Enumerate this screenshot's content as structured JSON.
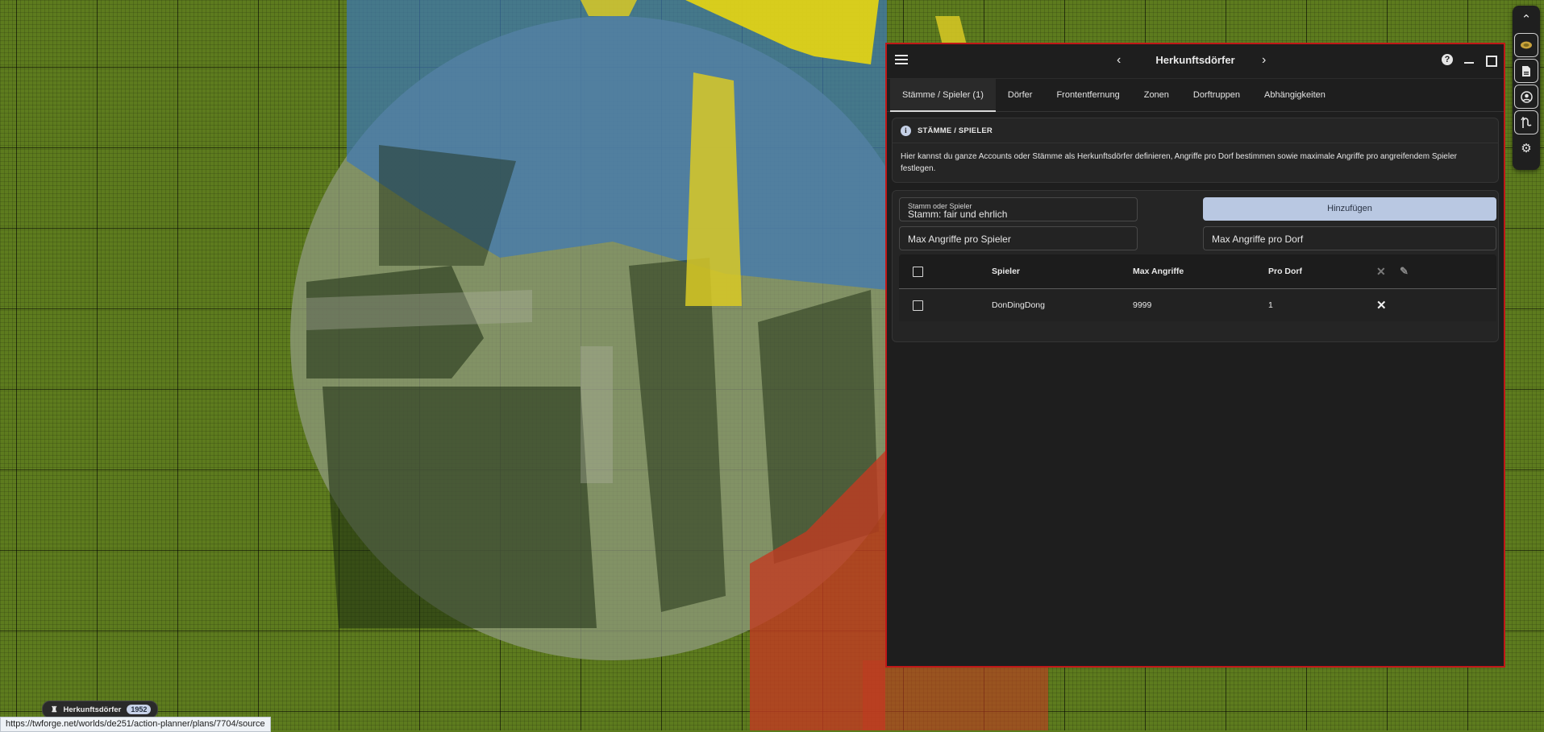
{
  "window": {
    "title": "Herkunftsdörfer",
    "prev_icon": "‹",
    "next_icon": "›"
  },
  "tabs": [
    {
      "label": "Stämme / Spieler (1)",
      "active": true
    },
    {
      "label": "Dörfer",
      "active": false
    },
    {
      "label": "Frontentfernung",
      "active": false
    },
    {
      "label": "Zonen",
      "active": false
    },
    {
      "label": "Dorftruppen",
      "active": false
    },
    {
      "label": "Abhängigkeiten",
      "active": false
    }
  ],
  "info": {
    "heading": "STÄMME / SPIELER",
    "text": "Hier kannst du ganze Accounts oder Stämme als Herkunftsdörfer definieren, Angriffe pro Dorf bestimmen sowie maximale Angriffe pro angreifendem Spieler festlegen."
  },
  "form": {
    "source_label": "Stamm oder Spieler",
    "source_value": "Stamm: fair und ehrlich",
    "add_button": "Hinzufügen",
    "max_per_player_placeholder": "Max Angriffe pro Spieler",
    "max_per_village_placeholder": "Max Angriffe pro Dorf"
  },
  "table": {
    "headers": {
      "player": "Spieler",
      "max": "Max Angriffe",
      "per_village": "Pro Dorf"
    },
    "rows": [
      {
        "player": "DonDingDong",
        "max": "9999",
        "per_village": "1"
      }
    ]
  },
  "footer": {
    "chip_label": "Herkunftsdörfer",
    "chip_count": "1952",
    "status_url": "https://twforge.net/worlds/de251/action-planner/plans/7704/source"
  },
  "colors": {
    "map_base": "#5d7b1e",
    "window_border": "#c01818",
    "accent_button": "#b9c8e2"
  }
}
